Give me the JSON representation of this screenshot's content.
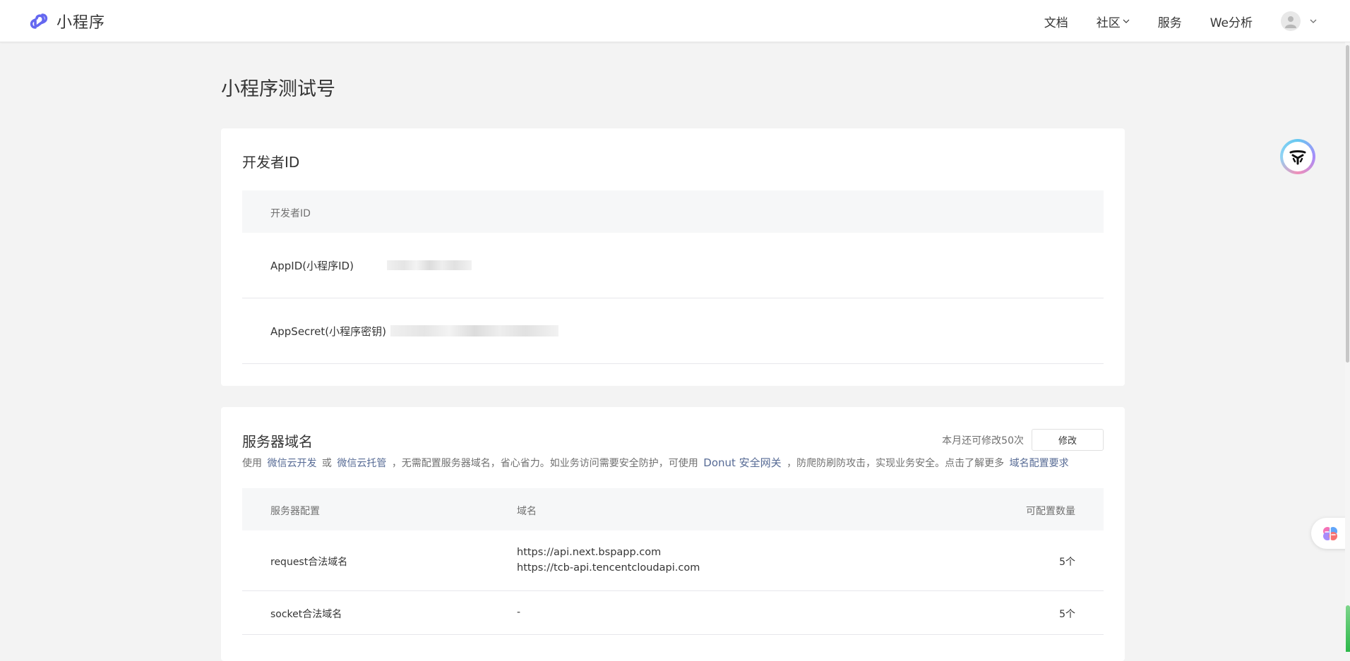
{
  "header": {
    "app_name": "小程序",
    "nav": [
      {
        "label": "文档"
      },
      {
        "label": "社区"
      },
      {
        "label": "服务"
      },
      {
        "label": "We分析"
      }
    ]
  },
  "page": {
    "title": "小程序测试号"
  },
  "developer_id": {
    "section_title": "开发者ID",
    "table_header": "开发者ID",
    "rows": [
      {
        "label": "AppID(小程序ID)",
        "value": "(redacted)"
      },
      {
        "label": "AppSecret(小程序密钥)",
        "value": "(redacted)"
      }
    ]
  },
  "server_domain": {
    "section_title": "服务器域名",
    "modify_hint": "本月还可修改50次",
    "modify_button": "修改",
    "desc": {
      "t1": "使用",
      "link1": "微信云开发",
      "t2": "或",
      "link2": "微信云托管",
      "t3": "，无需配置服务器域名，省心省力。如业务访问需要安全防护，可使用",
      "link3": "Donut 安全网关",
      "t4": "，防爬防刷防攻击，实现业务安全。点击了解更多",
      "link4": "域名配置要求"
    },
    "columns": [
      "服务器配置",
      "域名",
      "可配置数量"
    ],
    "rows": [
      {
        "config": "request合法域名",
        "domains": [
          "https://api.next.bspapp.com",
          "https://tcb-api.tencentcloudapi.com"
        ],
        "count": "5个"
      },
      {
        "config": "socket合法域名",
        "domains": [
          "-"
        ],
        "count": "5个"
      }
    ]
  },
  "colors": {
    "link": "#576b95",
    "brand": "#6467f0"
  }
}
